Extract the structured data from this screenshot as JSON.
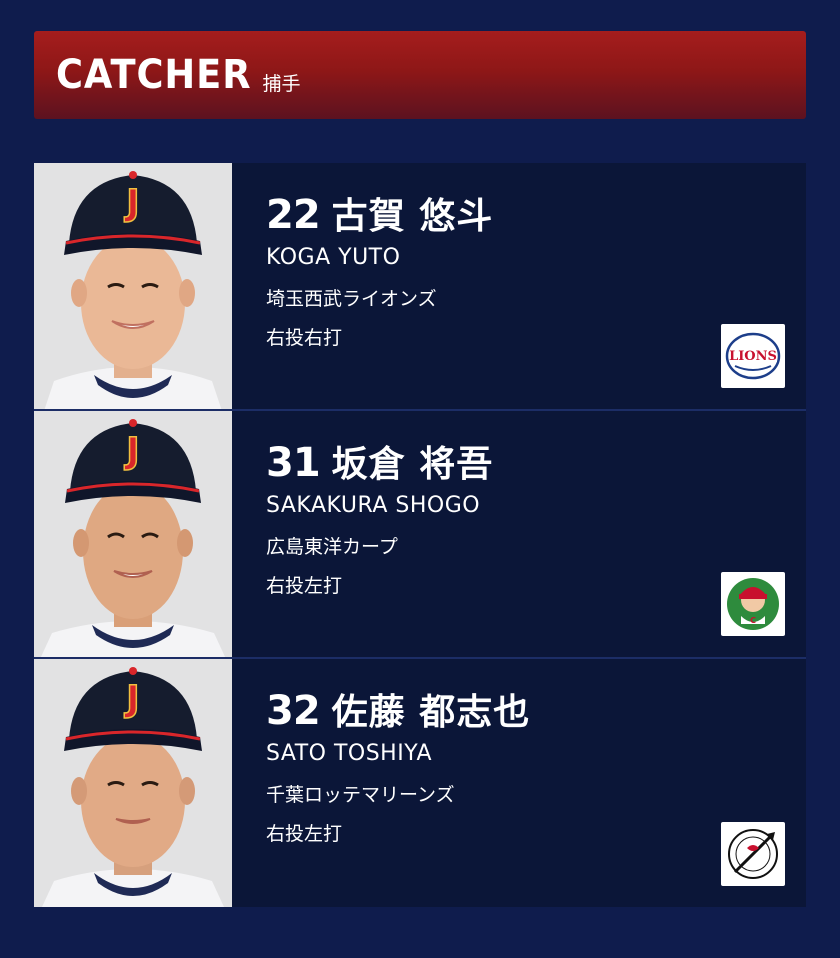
{
  "header": {
    "title": "CATCHER",
    "subtitle": "捕手"
  },
  "players": [
    {
      "number": "22",
      "name_jp": "古賀 悠斗",
      "name_en": "KOGA YUTO",
      "team": "埼玉西武ライオンズ",
      "handedness": "右投右打",
      "logo_icon": "lions-logo-icon"
    },
    {
      "number": "31",
      "name_jp": "坂倉 将吾",
      "name_en": "SAKAKURA SHOGO",
      "team": "広島東洋カープ",
      "handedness": "右投左打",
      "logo_icon": "carp-logo-icon"
    },
    {
      "number": "32",
      "name_jp": "佐藤 都志也",
      "name_en": "SATO TOSHIYA",
      "team": "千葉ロッテマリーンズ",
      "handedness": "右投左打",
      "logo_icon": "marines-logo-icon"
    }
  ],
  "colors": {
    "background": "#0f1c4d",
    "header_red": "#a51d1d",
    "card": "#0b1638",
    "cap": "#151c2e",
    "cap_logo": "#d9262a"
  }
}
